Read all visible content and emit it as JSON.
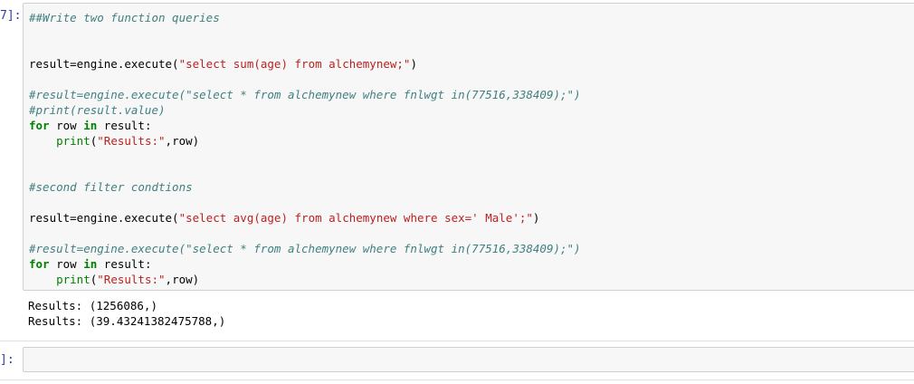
{
  "cell1": {
    "prompt": "7]:",
    "lines": {
      "l1": "##Write two function queries",
      "l4a": "result=engine.execute(",
      "l4b": "\"select sum(age) from alchemynew;\"",
      "l4c": ")",
      "l6": "#result=engine.execute(\"select * from alchemynew where fnlwgt in(77516,338409);\")",
      "l7": "#print(result.value)",
      "l8_for": "for",
      "l8_mid": " row ",
      "l8_in": "in",
      "l8_end": " result:",
      "l9_indent": "    ",
      "l9_print": "print",
      "l9_open": "(",
      "l9_str": "\"Results:\"",
      "l9_end": ",row)",
      "l12": "#second filter condtions",
      "l14a": "result=engine.execute(",
      "l14b": "\"select avg(age) from alchemynew where sex=' Male';\"",
      "l14c": ")",
      "l16": "#result=engine.execute(\"select * from alchemynew where fnlwgt in(77516,338409);\")",
      "l17_for": "for",
      "l17_mid": " row ",
      "l17_in": "in",
      "l17_end": " result:",
      "l18_indent": "    ",
      "l18_print": "print",
      "l18_open": "(",
      "l18_str": "\"Results:\"",
      "l18_end": ",row)"
    },
    "output": [
      "Results: (1256086,)",
      "Results: (39.43241382475788,)"
    ]
  },
  "cell2": {
    "prompt": "]:"
  }
}
